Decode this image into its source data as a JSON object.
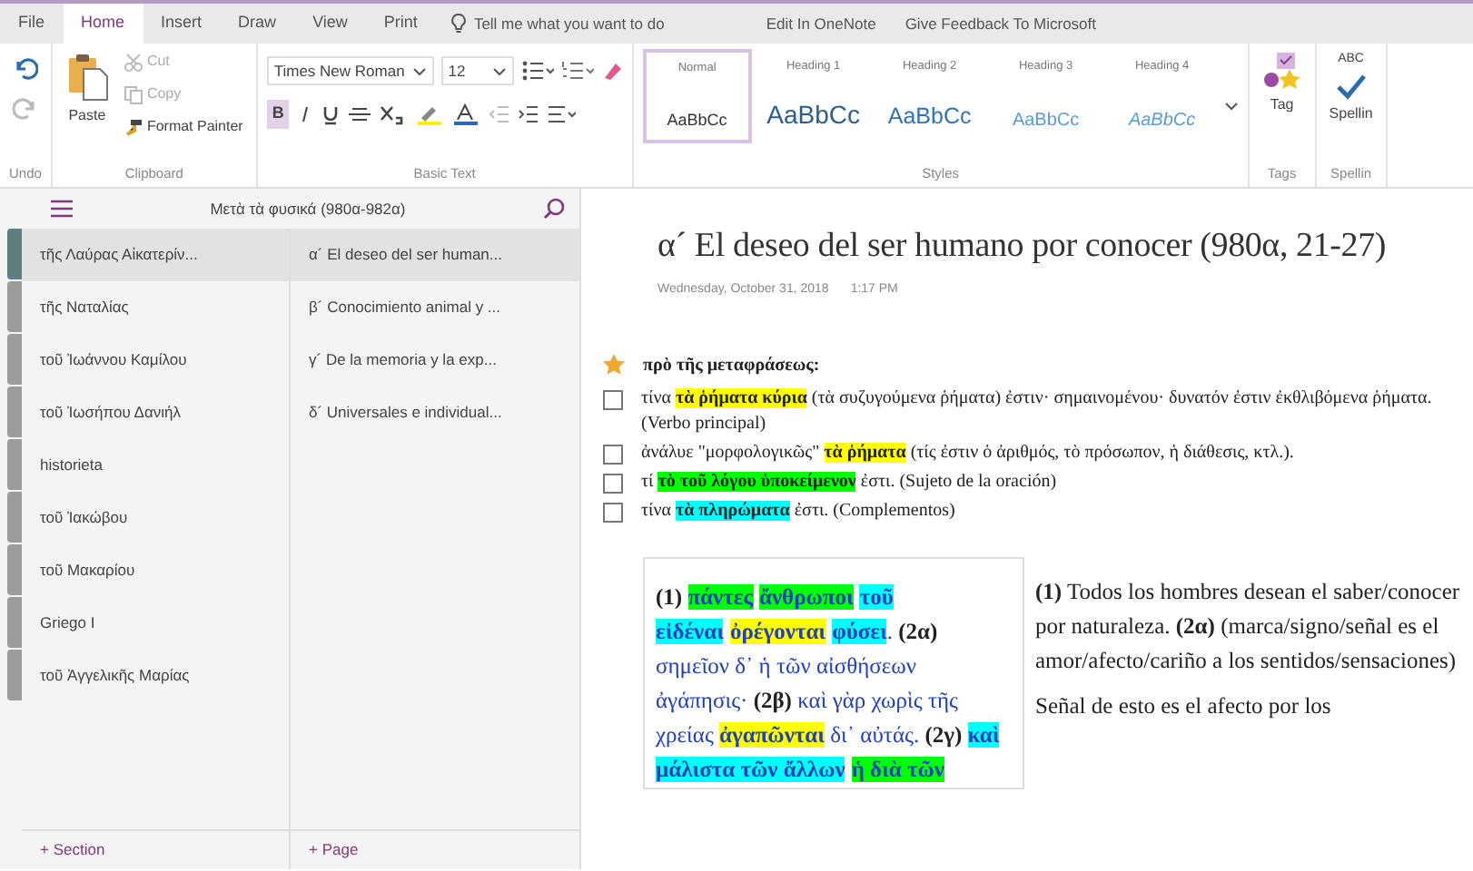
{
  "ribbon_tabs": [
    {
      "label": "File",
      "selected": false
    },
    {
      "label": "Home",
      "selected": true
    },
    {
      "label": "Insert",
      "selected": false
    },
    {
      "label": "Draw",
      "selected": false
    },
    {
      "label": "View",
      "selected": false
    },
    {
      "label": "Print",
      "selected": false
    }
  ],
  "tell_me": "Tell me what you want to do",
  "ribbon_links": [
    "Edit In OneNote",
    "Give Feedback To Microsoft"
  ],
  "ribbon": {
    "undo": {
      "label": "Undo",
      "buttons": [
        {
          "kind": "undo",
          "disabled": false
        },
        {
          "kind": "redo",
          "disabled": true
        }
      ]
    },
    "clipboard": {
      "paste": "Paste",
      "small": [
        {
          "kind": "cut",
          "label": "Cut",
          "disabled": true
        },
        {
          "kind": "copy",
          "label": "Copy",
          "disabled": true
        },
        {
          "kind": "painter",
          "label": "Format Painter",
          "disabled": false
        }
      ],
      "label": "Clipboard"
    },
    "basic_text": {
      "font": "Times New Roman",
      "size": "12",
      "bold": "B",
      "bold_selected": true,
      "label": "Basic Text"
    },
    "styles": {
      "items": [
        {
          "name": "Normal",
          "preview": "AaBbCc",
          "selected": true,
          "kind": "normal"
        },
        {
          "name": "Heading 1",
          "preview": "AaBbCc",
          "selected": false,
          "kind": "h1"
        },
        {
          "name": "Heading 2",
          "preview": "AaBbCc",
          "selected": false,
          "kind": "h2"
        },
        {
          "name": "Heading 3",
          "preview": "AaBbCc",
          "selected": false,
          "kind": "h3"
        },
        {
          "name": "Heading 4",
          "preview": "AaBbCc",
          "selected": false,
          "kind": "h4"
        }
      ],
      "label": "Styles"
    },
    "tags": {
      "button": "Tag",
      "label": "Tags"
    },
    "spelling": {
      "icon_text": "ABC",
      "button": "Spellin",
      "label": "Spellin"
    }
  },
  "notebook": {
    "title": "Μετὰ τὰ φυσικά (980α-982α)",
    "sections": [
      {
        "label": "τῆς Λαύρας Αἰκατερίν...",
        "selected": true,
        "color": "#5f7f7e"
      },
      {
        "label": "τῆς Ναταλίας",
        "selected": false,
        "color": "#9c9c9c"
      },
      {
        "label": "τοῦ Ἰωάννου Καμίλου",
        "selected": false,
        "color": "#9c9c9c"
      },
      {
        "label": "τοῦ Ἰωσήπου Δανιήλ",
        "selected": false,
        "color": "#9c9c9c"
      },
      {
        "label": "historieta",
        "selected": false,
        "color": "#9c9c9c"
      },
      {
        "label": "τοῦ Ἰακώβου",
        "selected": false,
        "color": "#9c9c9c"
      },
      {
        "label": "τοῦ Μακαρίου",
        "selected": false,
        "color": "#9c9c9c"
      },
      {
        "label": "Griego I",
        "selected": false,
        "color": "#9c9c9c"
      },
      {
        "label": "τοῦ Ἀγγελικῆς Μαρίας",
        "selected": false,
        "color": "#9c9c9c"
      }
    ],
    "pages": [
      {
        "label": "α´ El deseo del ser human...",
        "selected": true
      },
      {
        "label": "β´ Conocimiento animal y ...",
        "selected": false
      },
      {
        "label": "γ´ De la memoria y la exp...",
        "selected": false
      },
      {
        "label": "δ´ Universales e individual...",
        "selected": false
      }
    ],
    "add_section": "+ Section",
    "add_page": "+ Page"
  },
  "page": {
    "title": "α´ El deseo del ser humano por conocer (980α, 21-27)",
    "date": "Wednesday, October 31, 2018",
    "time": "1:17 PM",
    "tag_line": {
      "kind": "star",
      "text": "πρὸ τῆς μεταφράσεως:"
    },
    "todos": [
      {
        "checked": false,
        "segments": [
          {
            "text": "τίνα "
          },
          {
            "text": "τὰ ῥήματα κύρια",
            "color": "#ffff00"
          },
          {
            "text": " (τὰ συζυγούμενα ῥήματα) ἐστιν· σημαινομένου· δυνατόν ἐστιν ἐκθλιβόμενα ῥήματα. (Verbo principal)"
          }
        ]
      },
      {
        "checked": false,
        "segments": [
          {
            "text": "ἀνάλυε \"μορφολογικῶς\" "
          },
          {
            "text": "τὰ ῥήματα",
            "color": "#ffff00"
          },
          {
            "text": " (τίς ἐστιν ὁ ἀριθμός, τὸ πρόσωπον, ἡ διάθεσις, κτλ.)."
          }
        ]
      },
      {
        "checked": false,
        "segments": [
          {
            "text": "τί "
          },
          {
            "text": "τὸ τοῦ λόγου ὑποκείμενον",
            "color": "#00ff00"
          },
          {
            "text": " ἐστι. (Sujeto de la oración)"
          }
        ]
      },
      {
        "checked": false,
        "segments": [
          {
            "text": "τίνα "
          },
          {
            "text": "τὰ πληρώματα",
            "color": "#00ffff"
          },
          {
            "text": " ἐστι. (Complementos)"
          }
        ]
      }
    ],
    "table": {
      "greek": [
        {
          "text": "**(1)** "
        },
        {
          "text": "πάντες",
          "color": "#00ff00",
          "space_after": true
        },
        {
          "text": "ἄνθρωποι",
          "color": "#00ff00",
          "space_after": true
        },
        {
          "text": "τοῦ εἰδέναι",
          "color": "#00ffff",
          "space_after": true
        },
        {
          "text": "ὀρέγονται",
          "color": "#ffff00",
          "space_after": true
        },
        {
          "text": "φύσει",
          "color": "#00ffff"
        },
        {
          "text": ". **(2α)** σημεῖον δ᾽ ἡ τῶν αἰσθήσεων ἀγάπησις· **(2β)** καὶ γὰρ χωρὶς τῆς χρείας "
        },
        {
          "text": "ἀγαπῶνται",
          "color": "#ffff00"
        },
        {
          "text": " δι᾽ αὐτάς. **(2γ)** "
        },
        {
          "text": "καὶ μάλιστα τῶν ἄλλων",
          "color": "#00ffff",
          "space_after": true
        },
        {
          "text": "ἡ διὰ τῶν",
          "color": "#00ff00"
        }
      ],
      "spanish": [
        "**(1)** Todos los hombres desean el saber/conocer por naturaleza. **(2α)** (marca/signo/señal es el amor/afecto/cariño a los sentidos/sensaciones)",
        "Señal de esto es el afecto por los"
      ]
    }
  }
}
